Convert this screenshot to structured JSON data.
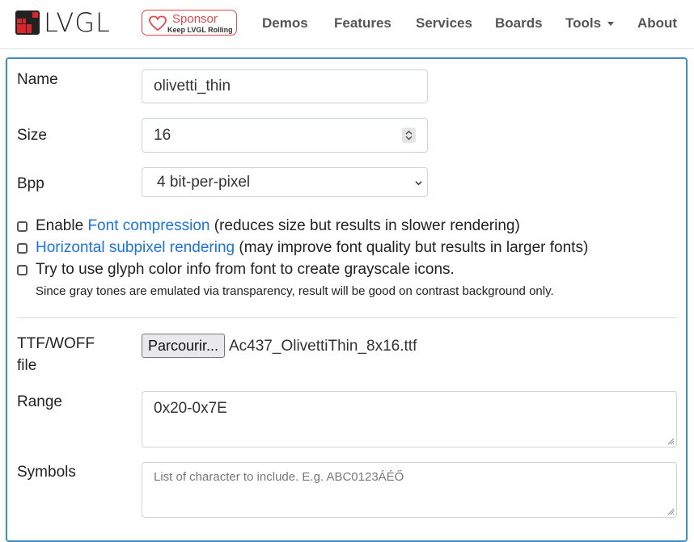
{
  "brand": {
    "name": "LVGL"
  },
  "sponsor": {
    "title": "Sponsor",
    "subtitle": "Keep LVGL Rolling"
  },
  "nav": {
    "demos": "Demos",
    "features": "Features",
    "services": "Services",
    "boards": "Boards",
    "tools": "Tools",
    "about": "About"
  },
  "form": {
    "name_label": "Name",
    "name_value": "olivetti_thin",
    "size_label": "Size",
    "size_value": "16",
    "bpp_label": "Bpp",
    "bpp_value": "4 bit-per-pixel",
    "opt1_prefix": "Enable ",
    "opt1_link": "Font compression",
    "opt1_suffix": " (reduces size but results in slower rendering)",
    "opt2_link": "Horizontal subpixel rendering",
    "opt2_suffix": " (may improve font quality but results in larger fonts)",
    "opt3_text": "Try to use glyph color info from font to create grayscale icons.",
    "opt3_note": "Since gray tones are emulated via transparency, result will be good on contrast background only.",
    "file_label_1": "TTF/WOFF",
    "file_label_2": "file",
    "file_button": "Parcourir...",
    "file_name": "Ac437_OlivettiThin_8x16.ttf",
    "range_label": "Range",
    "range_value": "0x20-0x7E",
    "symbols_label": "Symbols",
    "symbols_placeholder": "List of character to include. E.g. ABC0123ÁÉŐ"
  },
  "colors": {
    "accent": "#3c8dc7",
    "link": "#1a73e8",
    "sponsor": "#e5484d",
    "logo_red": "#d8262c"
  }
}
